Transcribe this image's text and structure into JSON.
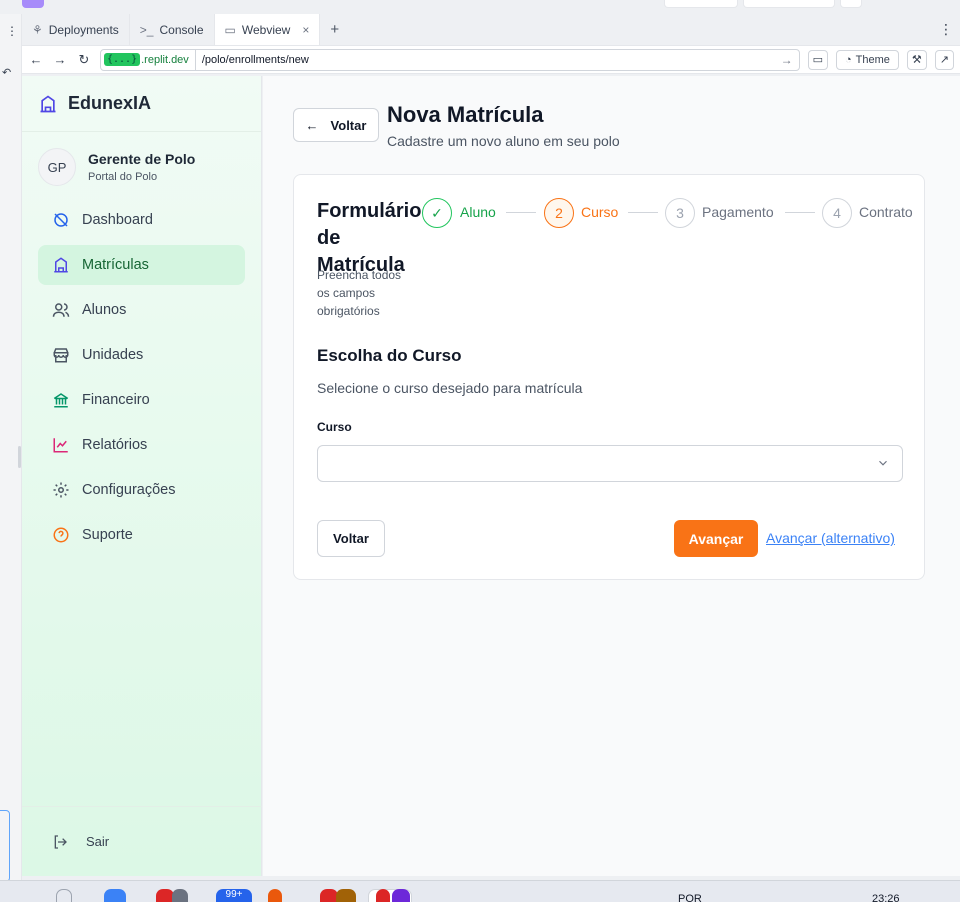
{
  "browser": {
    "tabs": [
      {
        "label": "Deployments",
        "icon": "tree-icon"
      },
      {
        "label": "Console",
        "icon": "terminal-icon"
      },
      {
        "label": "Webview",
        "icon": "monitor-icon",
        "active": true
      }
    ],
    "url_badge": "{...}",
    "url_domain": ".replit.dev",
    "url_path": "/polo/enrollments/new",
    "theme_label": "Theme"
  },
  "app": {
    "brand": "EdunexIA",
    "user": {
      "initials": "GP",
      "name": "Gerente de Polo",
      "role": "Portal do Polo"
    },
    "nav": [
      {
        "label": "Dashboard",
        "icon": "dashboard-icon"
      },
      {
        "label": "Matrículas",
        "icon": "building-icon",
        "active": true
      },
      {
        "label": "Alunos",
        "icon": "users-icon"
      },
      {
        "label": "Unidades",
        "icon": "store-icon"
      },
      {
        "label": "Financeiro",
        "icon": "bank-icon"
      },
      {
        "label": "Relatórios",
        "icon": "chart-icon"
      },
      {
        "label": "Configurações",
        "icon": "gear-icon"
      },
      {
        "label": "Suporte",
        "icon": "help-icon"
      }
    ],
    "logout_label": "Sair"
  },
  "page": {
    "back_label": "Voltar",
    "title": "Nova Matrícula",
    "subtitle": "Cadastre um novo aluno em seu polo"
  },
  "form": {
    "title": "Formulário de Matrícula",
    "description": "Preencha todos os campos obrigatórios",
    "steps": [
      {
        "number": "1",
        "label": "Aluno",
        "status": "done"
      },
      {
        "number": "2",
        "label": "Curso",
        "status": "current"
      },
      {
        "number": "3",
        "label": "Pagamento",
        "status": "todo"
      },
      {
        "number": "4",
        "label": "Contrato",
        "status": "todo"
      }
    ],
    "section_title": "Escolha do Curso",
    "section_subtitle": "Selecione o curso desejado para matrícula",
    "course_label": "Curso",
    "course_value": "",
    "back_button": "Voltar",
    "next_button": "Avançar",
    "alt_link": "Avançar (alternativo)"
  },
  "taskbar": {
    "badge_99": "99+",
    "lang": "POR",
    "time": "23:26"
  },
  "colors": {
    "accent_orange": "#f97316",
    "success_green": "#22c55e",
    "brand_indigo": "#4f46e5",
    "link_blue": "#3b82f6"
  }
}
